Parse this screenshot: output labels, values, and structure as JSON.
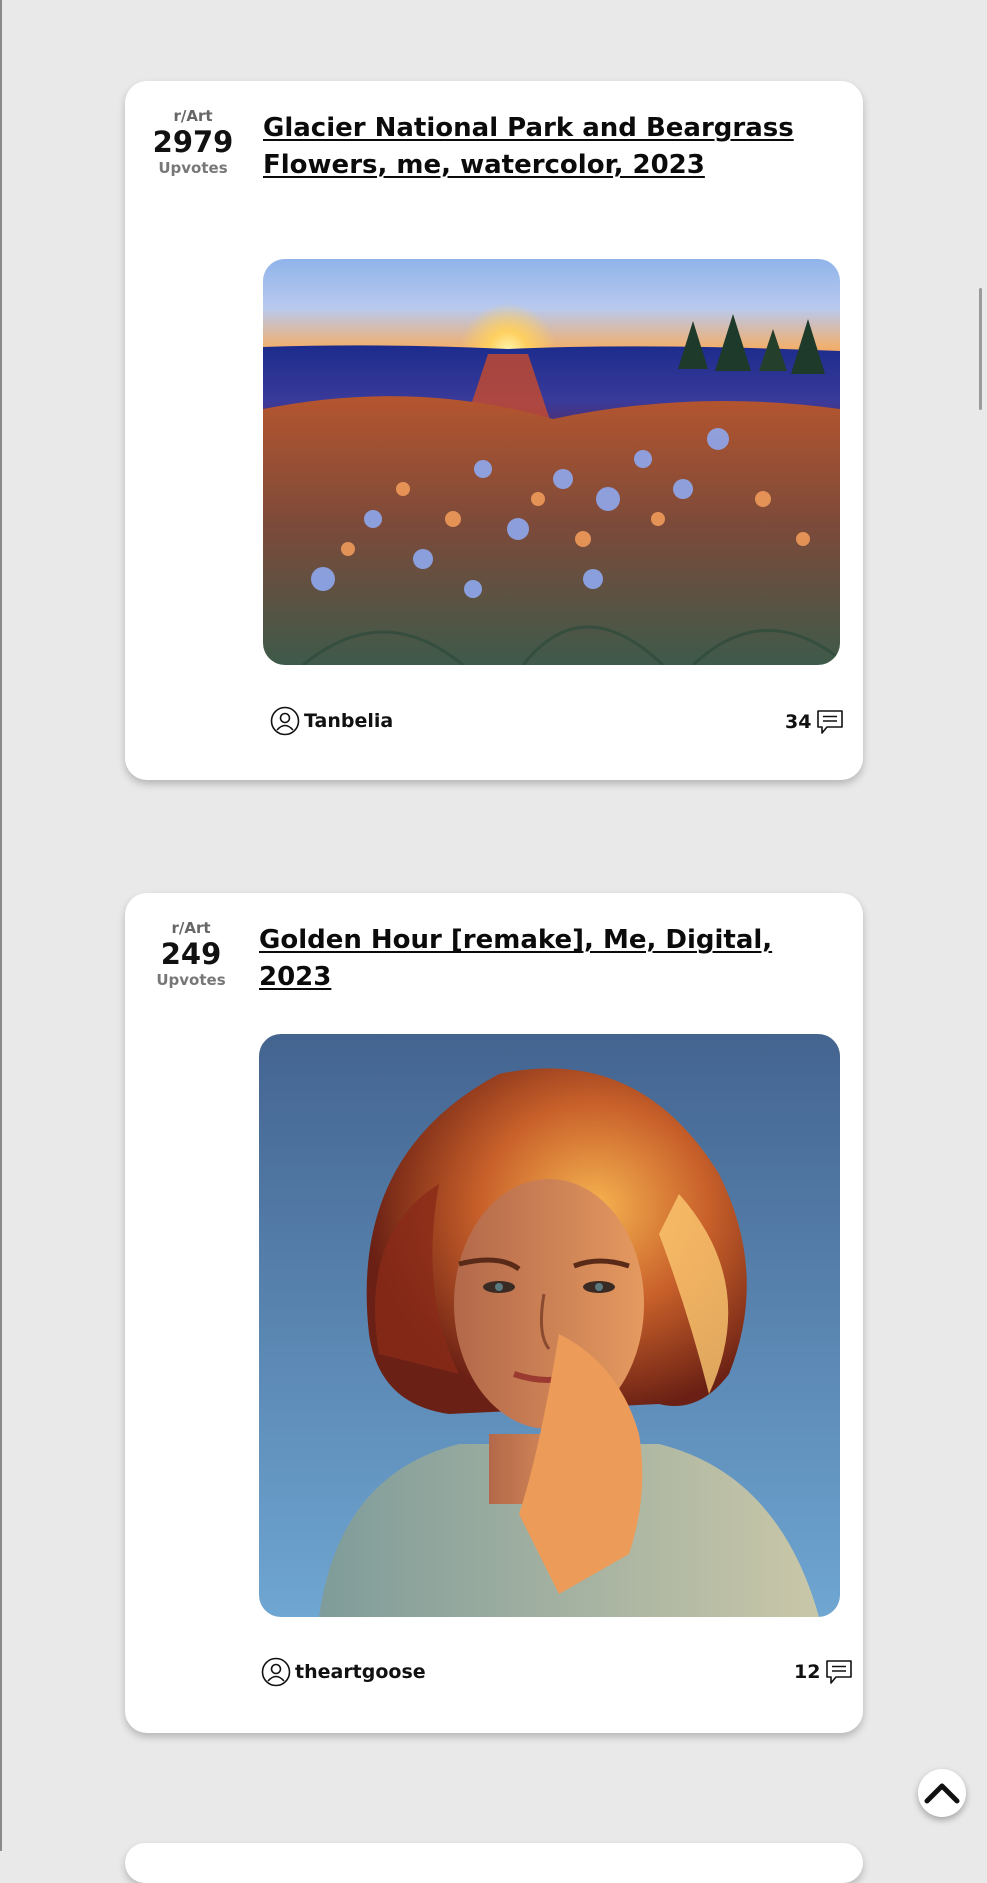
{
  "posts": [
    {
      "subreddit": "r/Art",
      "score": "2979",
      "score_label": "Upvotes",
      "title": "Glacier National Park and Beargrass Flowers, me, watercolor, 2023",
      "author": "Tanbelia",
      "comments": "34",
      "image_icon": "landscape-painting"
    },
    {
      "subreddit": "r/Art",
      "score": "249",
      "score_label": "Upvotes",
      "title": "Golden Hour [remake], Me, Digital, 2023",
      "author": "theartgoose",
      "comments": "12",
      "image_icon": "portrait-painting"
    }
  ],
  "icons": {
    "user": "user-circle-icon",
    "comment": "comment-icon",
    "back_to_top": "chevron-up-icon"
  },
  "colors": {
    "background": "#e9e9e9",
    "card": "#ffffff",
    "text": "#111111",
    "muted": "#777777"
  }
}
